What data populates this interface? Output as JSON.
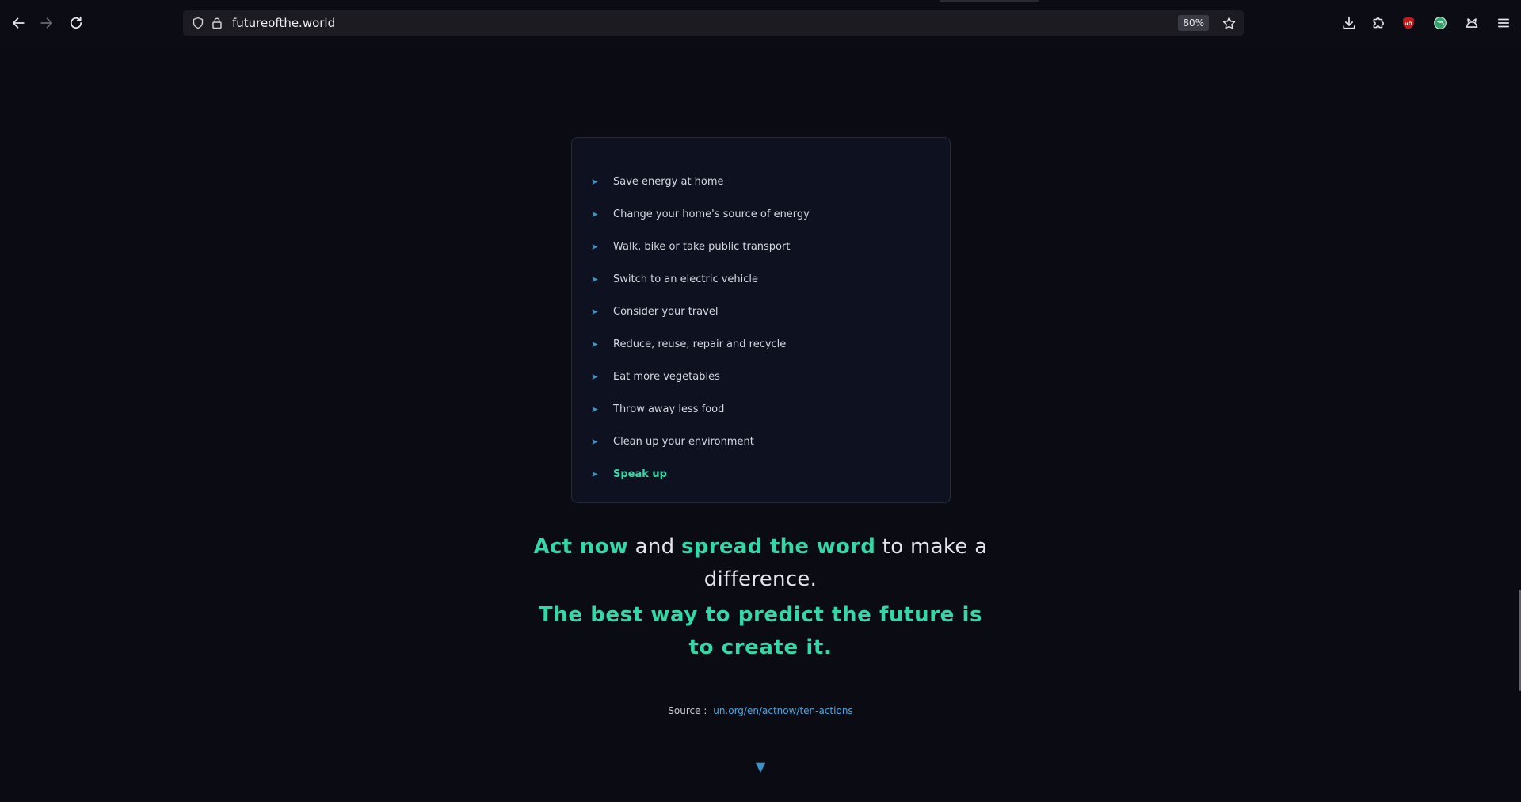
{
  "browser": {
    "url": "futureofthe.world",
    "zoom": "80%",
    "icons": {
      "back": "arrow-left-icon",
      "forward": "arrow-right-icon",
      "reload": "reload-icon",
      "shield": "shield-icon",
      "lock": "lock-icon",
      "bookmark": "star-icon",
      "downloads": "download-icon",
      "extensions": "puzzle-icon",
      "ublock": "ublock-origin-icon",
      "extension_green": "globe-extension-icon",
      "extension_cat": "cat-extension-icon",
      "menu": "hamburger-menu-icon"
    }
  },
  "actions": {
    "items": [
      "Save energy at home",
      "Change your home's source of energy",
      "Walk, bike or take public transport",
      "Switch to an electric vehicle",
      "Consider your travel",
      "Reduce, reuse, repair and recycle",
      "Eat more vegetables",
      "Throw away less food",
      "Clean up your environment",
      "Speak up"
    ]
  },
  "tagline": {
    "part1": "Act now",
    "part2": " and ",
    "part3": "spread the word",
    "part4": " to make a difference."
  },
  "motto": "The best way to predict the future is to create it.",
  "source": {
    "label": "Source :",
    "link": "un.org/en/actnow/ten-actions"
  },
  "scroll_hint": "▼",
  "colors": {
    "accent": "#35d6a8",
    "link": "#4aa6e0",
    "background": "#0a0b13",
    "card": "#0e1220"
  }
}
